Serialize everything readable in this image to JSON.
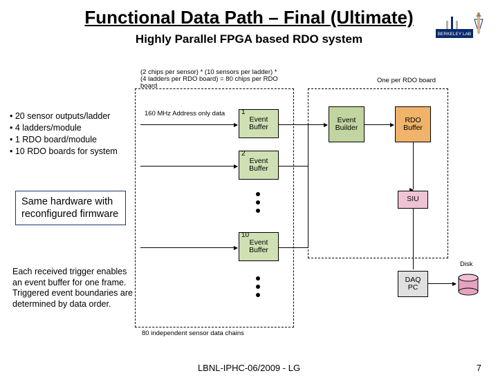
{
  "title": "Functional Data Path – Final (Ultimate)",
  "subtitle": "Highly Parallel FPGA based RDO system",
  "bullets": [
    "20 sensor outputs/ladder",
    "4 ladders/module",
    "1 RDO board/module",
    "10 RDO boards for system"
  ],
  "callout": "Same hardware with reconfigured firmware",
  "trigger_note": "Each received trigger enables an event buffer for one frame. Triggered event boundaries are determined by data order.",
  "footer": {
    "left": "LBNL-IPHC-06/2009 - LG",
    "page": "7"
  },
  "logo": {
    "text": "BERKELEY LAB"
  },
  "diagram": {
    "dash1_label": "(2 chips per sensor) * (10 sensors per ladder) *\n(4 ladders per RDO board) = 80 chips per RDO board",
    "dash2_label": "One per RDO board",
    "addr_label": "160 MHz Address only data",
    "buffers": [
      {
        "num": "1",
        "label": "Event\nBuffer"
      },
      {
        "num": "2",
        "label": "Event\nBuffer"
      },
      {
        "num": "10",
        "label": "Event\nBuffer"
      }
    ],
    "event_builder": "Event\nBuilder",
    "rdo_buffer": "RDO\nBuffer",
    "siu": "SIU",
    "daq_pc": "DAQ\nPC",
    "disk": "Disk",
    "bottom_label": "80 independent sensor data chains"
  }
}
